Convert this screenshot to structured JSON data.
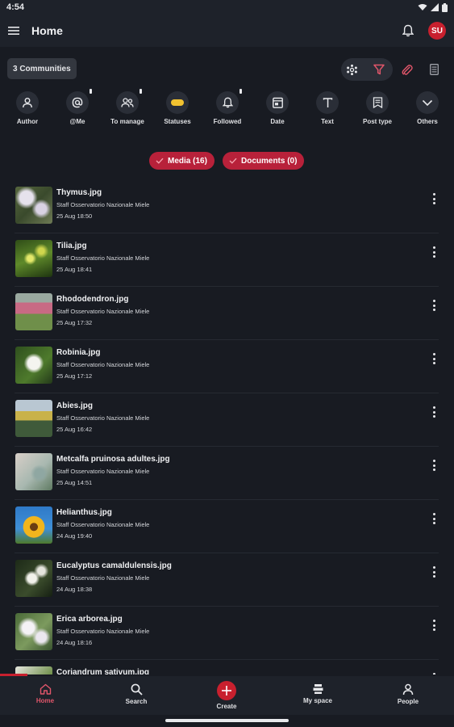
{
  "status_bar": {
    "time": "4:54"
  },
  "app_bar": {
    "title": "Home",
    "avatar_initials": "SU"
  },
  "toolbar": {
    "communities_label": "3 Communities"
  },
  "filters": [
    {
      "label": "Author",
      "icon": "person-icon"
    },
    {
      "label": "@Me",
      "icon": "at-icon"
    },
    {
      "label": "To manage",
      "icon": "people-icon"
    },
    {
      "label": "Statuses",
      "icon": "status-pill-icon"
    },
    {
      "label": "Followed",
      "icon": "bell-icon"
    },
    {
      "label": "Date",
      "icon": "calendar-icon"
    },
    {
      "label": "Text",
      "icon": "text-icon"
    },
    {
      "label": "Post type",
      "icon": "post-type-icon"
    },
    {
      "label": "Others",
      "icon": "chevron-down-icon"
    }
  ],
  "chips": [
    {
      "label": "Media (16)"
    },
    {
      "label": "Documents (0)"
    }
  ],
  "items": [
    {
      "title": "Thymus.jpg",
      "author": "Staff Osservatorio Nazionale Miele",
      "date": "25 Aug 18:50"
    },
    {
      "title": "Tilia.jpg",
      "author": "Staff Osservatorio Nazionale Miele",
      "date": "25 Aug 18:41"
    },
    {
      "title": "Rhododendron.jpg",
      "author": "Staff Osservatorio Nazionale Miele",
      "date": "25 Aug 17:32"
    },
    {
      "title": "Robinia.jpg",
      "author": "Staff Osservatorio Nazionale Miele",
      "date": "25 Aug 17:12"
    },
    {
      "title": "Abies.jpg",
      "author": "Staff Osservatorio Nazionale Miele",
      "date": "25 Aug 16:42"
    },
    {
      "title": "Metcalfa pruinosa adultes.jpg",
      "author": "Staff Osservatorio Nazionale Miele",
      "date": "25 Aug 14:51"
    },
    {
      "title": "Helianthus.jpg",
      "author": "Staff Osservatorio Nazionale Miele",
      "date": "24 Aug 19:40"
    },
    {
      "title": "Eucalyptus camaldulensis.jpg",
      "author": "Staff Osservatorio Nazionale Miele",
      "date": "24 Aug 18:38"
    },
    {
      "title": "Erica arborea.jpg",
      "author": "Staff Osservatorio Nazionale Miele",
      "date": "24 Aug 18:16"
    },
    {
      "title": "Coriandrum sativum.jpg",
      "author": "",
      "date": ""
    }
  ],
  "bottom_nav": [
    {
      "label": "Home",
      "icon": "home-icon",
      "active": true
    },
    {
      "label": "Search",
      "icon": "search-icon",
      "active": false
    },
    {
      "label": "Create",
      "icon": "plus-icon",
      "active": false
    },
    {
      "label": "My space",
      "icon": "my-space-icon",
      "active": false
    },
    {
      "label": "People",
      "icon": "person-icon",
      "active": false
    }
  ],
  "scroll_progress": 0.06,
  "colors": {
    "background": "#181b22",
    "surface": "#1e222a",
    "accent": "#c8202e",
    "chip": "#b8213a"
  }
}
